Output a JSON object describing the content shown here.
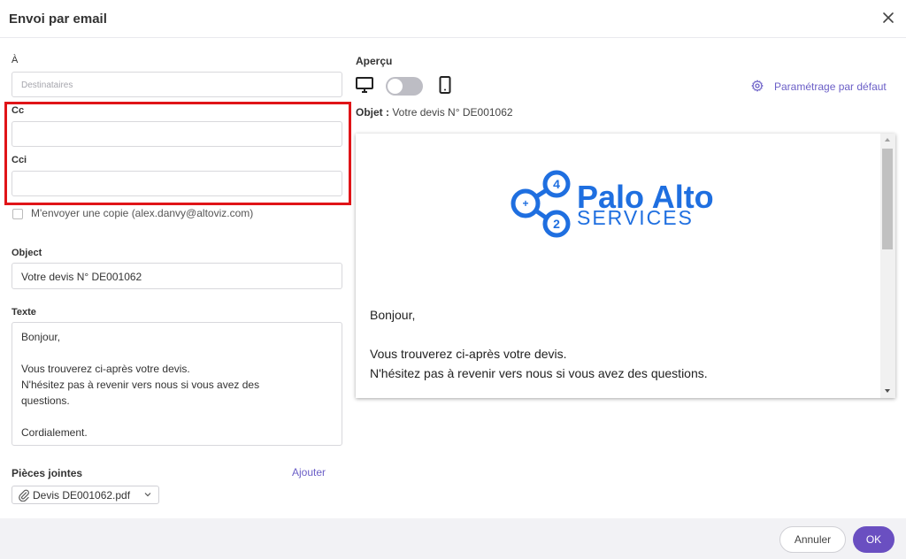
{
  "dialog": {
    "title": "Envoi par email",
    "close_icon": "close-icon"
  },
  "form": {
    "to_label": "À",
    "to_placeholder": "Destinataires",
    "cc_label": "Cc",
    "cc_value": "",
    "bcc_label": "Cci",
    "bcc_value": "",
    "copy_checkbox_label": "M'envoyer une copie (alex.danvy@altoviz.com)",
    "copy_checked": false,
    "subject_label": "Object",
    "subject_value": "Votre devis N° DE001062",
    "text_label": "Texte",
    "text_lines": [
      "Bonjour,",
      "",
      "Vous trouverez ci-après votre devis.",
      "N'hésitez pas à revenir vers nous si vous avez des",
      "questions.",
      "",
      "Cordialement."
    ],
    "attachments_label": "Pièces jointes",
    "add_attachment_label": "Ajouter",
    "attachments": [
      {
        "name": "Devis DE001062.pdf"
      }
    ]
  },
  "preview": {
    "label": "Aperçu",
    "view_mode": "desktop",
    "settings_link": "Paramétrage par défaut",
    "subject_prefix": "Objet :",
    "subject": "Votre devis N° DE001062",
    "logo": {
      "line1": "Palo Alto",
      "line2": "SERVICES",
      "badges": [
        "+",
        "4",
        "2"
      ],
      "color": "#1f6fe0"
    },
    "body_lines": [
      "Bonjour,",
      "",
      "Vous trouverez ci-après votre devis.",
      "N'hésitez pas à revenir vers nous si vous avez des questions."
    ]
  },
  "footer": {
    "cancel_label": "Annuler",
    "ok_label": "OK"
  },
  "colors": {
    "accent": "#6a4fc1",
    "link": "#6b5fc7",
    "highlight_border": "#e01418"
  },
  "icons": [
    "close-icon",
    "desktop-icon",
    "mobile-icon",
    "gear-icon",
    "paperclip-icon",
    "chevron-down-icon"
  ]
}
